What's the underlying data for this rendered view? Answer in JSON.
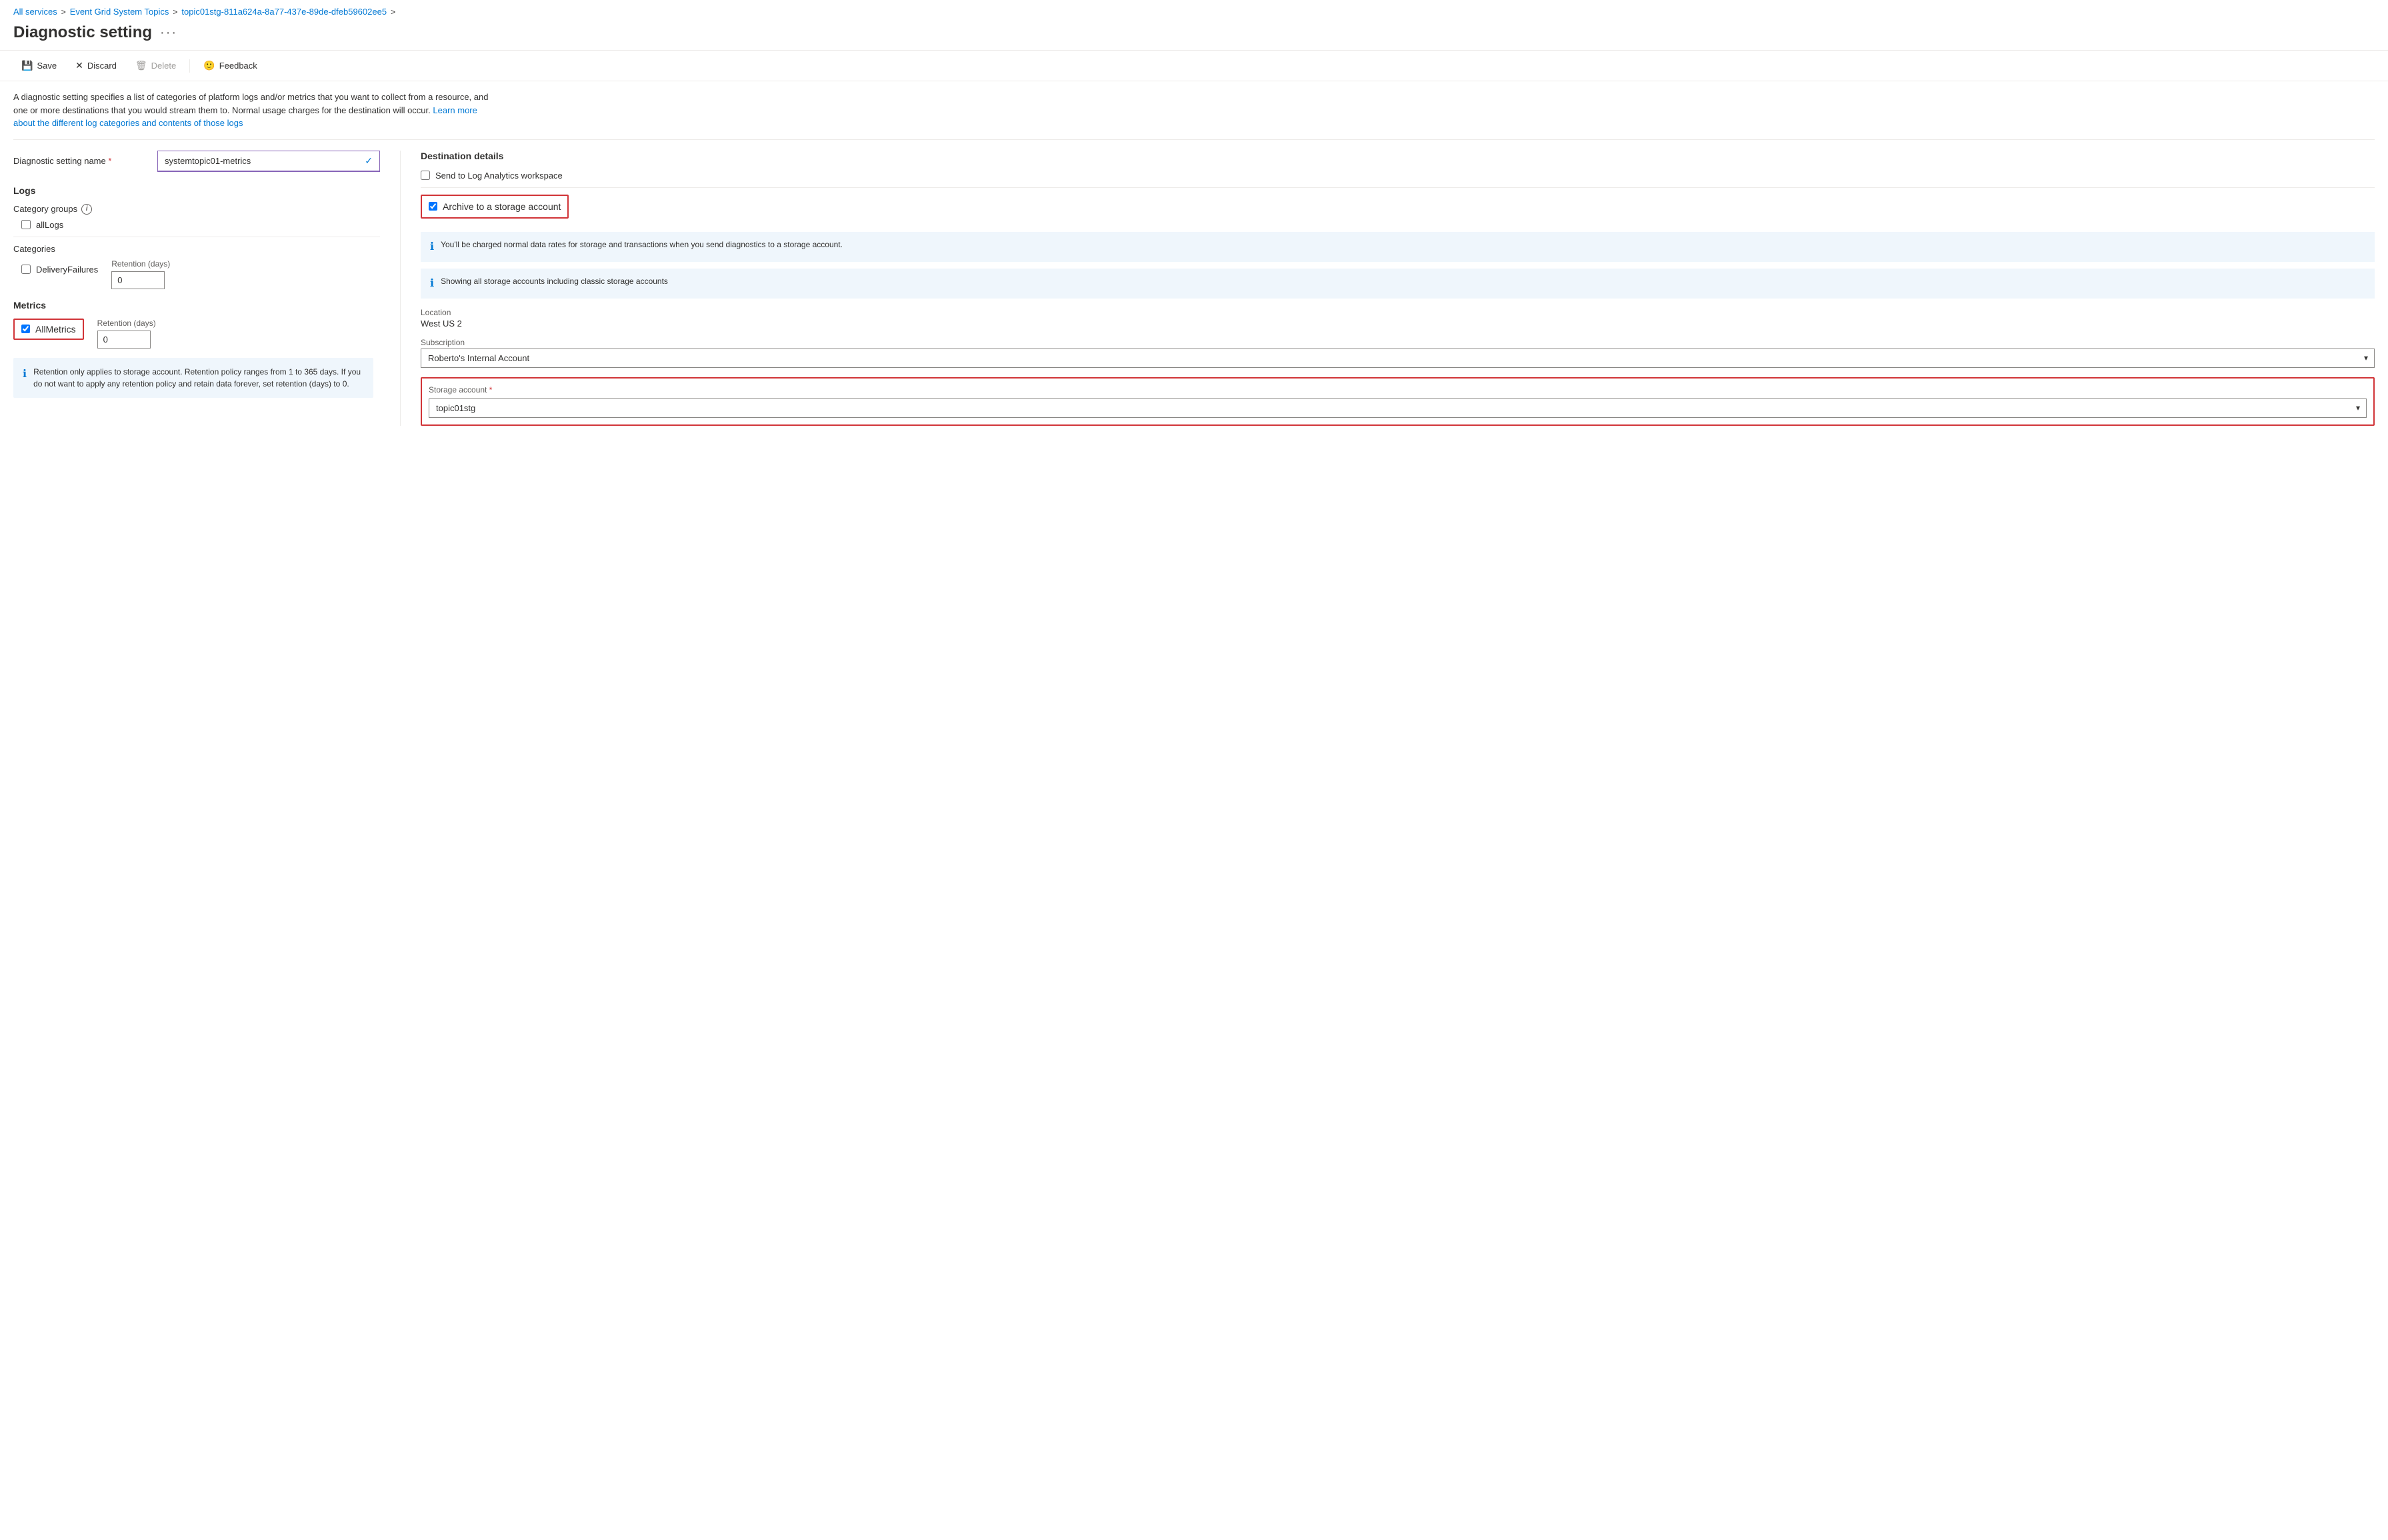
{
  "breadcrumb": {
    "all_services": "All services",
    "event_grid": "Event Grid System Topics",
    "topic": "topic01stg-811a624a-8a77-437e-89de-dfeb59602ee5",
    "sep": ">"
  },
  "page": {
    "title": "Diagnostic setting",
    "ellipsis": "···"
  },
  "toolbar": {
    "save": "Save",
    "discard": "Discard",
    "delete": "Delete",
    "feedback": "Feedback"
  },
  "description": {
    "text": "A diagnostic setting specifies a list of categories of platform logs and/or metrics that you want to collect from a resource, and one or more destinations that you would stream them to. Normal usage charges for the destination will occur.",
    "link_text": "Learn more about the different log categories and contents of those logs"
  },
  "diagnostic_name": {
    "label": "Diagnostic setting name",
    "required": "*",
    "value": "systemtopic01-metrics",
    "check": "✓"
  },
  "logs": {
    "section_title": "Logs",
    "category_groups": {
      "label": "Category groups",
      "info": "i",
      "items": [
        {
          "id": "allLogs",
          "label": "allLogs",
          "checked": false
        }
      ]
    },
    "categories": {
      "label": "Categories",
      "items": [
        {
          "id": "deliveryFailures",
          "label": "DeliveryFailures",
          "checked": false,
          "retention_label": "Retention (days)",
          "retention_value": "0"
        }
      ]
    }
  },
  "metrics": {
    "section_title": "Metrics",
    "items": [
      {
        "id": "allMetrics",
        "label": "AllMetrics",
        "checked": true,
        "retention_label": "Retention (days)",
        "retention_value": "0"
      }
    ],
    "info_text": "Retention only applies to storage account. Retention policy ranges from 1 to 365 days. If you do not want to apply any retention policy and retain data forever, set retention (days) to 0."
  },
  "destination": {
    "title": "Destination details",
    "log_analytics": {
      "label": "Send to Log Analytics workspace",
      "checked": false
    },
    "archive": {
      "label": "Archive to a storage account",
      "checked": true
    },
    "info1": "You'll be charged normal data rates for storage and transactions when you send diagnostics to a storage account.",
    "info2": "Showing all storage accounts including classic storage accounts",
    "location": {
      "label": "Location",
      "value": "West US 2"
    },
    "subscription": {
      "label": "Subscription",
      "value": "Roberto's Internal Account",
      "options": [
        "Roberto's Internal Account"
      ]
    },
    "storage_account": {
      "label": "Storage account",
      "required": "*",
      "value": "topic01stg",
      "options": [
        "topic01stg"
      ]
    }
  }
}
